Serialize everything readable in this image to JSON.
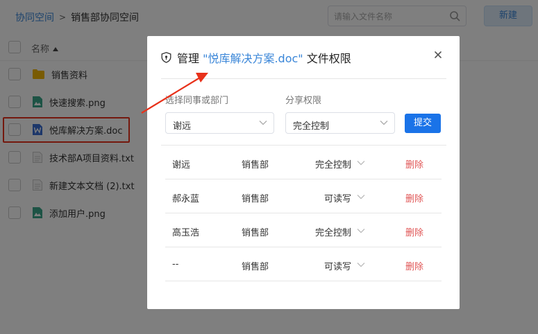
{
  "breadcrumb": {
    "root": "协同空间",
    "separator": ">",
    "current": "销售部协同空间"
  },
  "search": {
    "placeholder": "请输入文件名称"
  },
  "toolbar": {
    "new_label": "新建"
  },
  "list": {
    "header_label": "名称",
    "files": [
      {
        "name": "销售资料",
        "icon": "folder-icon"
      },
      {
        "name": "快速搜索.png",
        "icon": "image-file-icon"
      },
      {
        "name": "悦库解决方案.doc",
        "icon": "word-file-icon"
      },
      {
        "name": "技术部A项目资料.txt",
        "icon": "text-file-icon"
      },
      {
        "name": "新建文本文档 (2).txt",
        "icon": "text-file-icon"
      },
      {
        "name": "添加用户.png",
        "icon": "image-file-icon"
      }
    ]
  },
  "dialog": {
    "title_prefix": "管理 ",
    "title_file": "\"悦库解决方案.doc\"",
    "title_suffix": " 文件权限",
    "colleague_label": "选择同事或部门",
    "permission_label": "分享权限",
    "colleague_value": "谢远",
    "permission_value": "完全控制",
    "submit_label": "提交",
    "rows": [
      {
        "user": "谢远",
        "dept": "销售部",
        "permission": "完全控制",
        "action": "删除"
      },
      {
        "user": "郝永蓝",
        "dept": "销售部",
        "permission": "可读写",
        "action": "删除"
      },
      {
        "user": "高玉浩",
        "dept": "销售部",
        "permission": "完全控制",
        "action": "删除"
      },
      {
        "user": "--",
        "dept": "销售部",
        "permission": "可读写",
        "action": "删除"
      }
    ]
  },
  "colors": {
    "accent": "#1a73e8",
    "link": "#3a86d8",
    "danger": "#e05656",
    "highlight": "#e8311a"
  }
}
